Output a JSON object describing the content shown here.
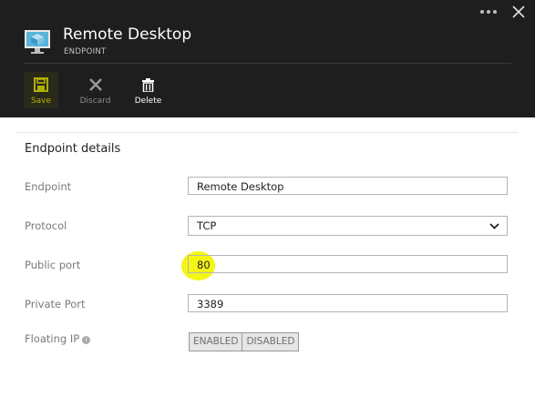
{
  "header": {
    "title": "Remote Desktop",
    "subtitle": "ENDPOINT",
    "icon": "virtual-machine-icon",
    "controls": {
      "more_icon": "ellipsis-icon",
      "close_icon": "close-icon"
    }
  },
  "toolbar": {
    "save_label": "Save",
    "discard_label": "Discard",
    "delete_label": "Delete"
  },
  "form": {
    "section_title": "Endpoint details",
    "endpoint": {
      "label": "Endpoint",
      "value": "Remote Desktop"
    },
    "protocol": {
      "label": "Protocol",
      "value": "TCP"
    },
    "public_port": {
      "label": "Public port",
      "value": "80"
    },
    "private_port": {
      "label": "Private Port",
      "value": "3389"
    },
    "floating_ip": {
      "label": "Floating IP",
      "info": "i",
      "options": [
        "ENABLED",
        "DISABLED"
      ]
    }
  },
  "colors": {
    "header_bg": "#1e1e1e",
    "save_accent": "#b4b000",
    "highlight": "#f4f40a",
    "azure_blue": "#3aa0dc"
  }
}
